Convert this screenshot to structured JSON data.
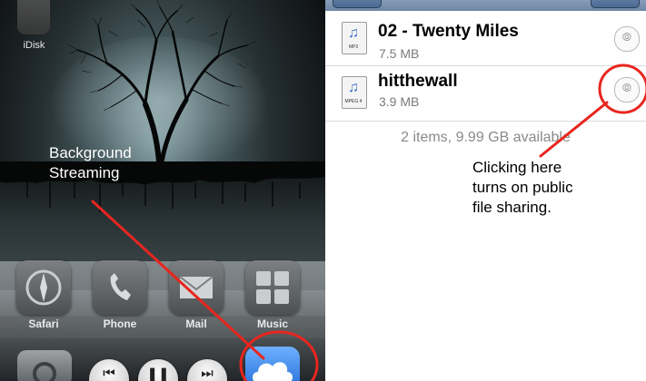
{
  "left": {
    "idisk_label": "iDisk",
    "background_label": [
      "Background",
      "Streaming"
    ],
    "dock_apps": [
      "Safari",
      "Phone",
      "Mail",
      "Music"
    ]
  },
  "right": {
    "files": [
      {
        "name": "02 - Twenty Miles",
        "size": "7.5 MB",
        "type": "MP3"
      },
      {
        "name": "hitthewall",
        "size": "3.9 MB",
        "type": "MPEG 4"
      }
    ],
    "summary": "2 items, 9.99 GB available",
    "annotation": [
      "Clicking here",
      "turns on public",
      "file sharing."
    ]
  },
  "colors": {
    "annotation": "#e8261f",
    "nav_tint": "#6e86a6",
    "cloud": "#1f6ad6"
  },
  "icons": [
    "idisk-icon",
    "safari-icon",
    "phone-icon",
    "mail-icon",
    "music-icon",
    "rewind-icon",
    "pause-icon",
    "fast-forward-icon",
    "cloud-icon",
    "audio-file-icon",
    "share-icon"
  ]
}
